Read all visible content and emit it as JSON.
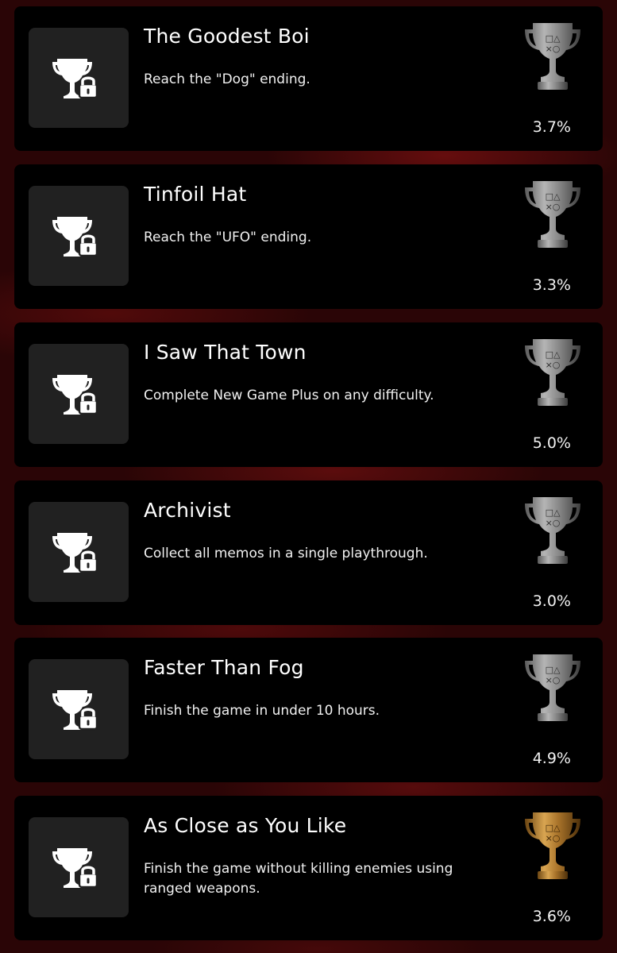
{
  "trophies": [
    {
      "title": "The Goodest Boi",
      "description": "Reach the \"Dog\" ending.",
      "rarity": "3.7%",
      "grade": "silver"
    },
    {
      "title": "Tinfoil Hat",
      "description": "Reach the \"UFO\" ending.",
      "rarity": "3.3%",
      "grade": "silver"
    },
    {
      "title": "I Saw That Town",
      "description": "Complete New Game Plus on any difficulty.",
      "rarity": "5.0%",
      "grade": "silver"
    },
    {
      "title": "Archivist",
      "description": "Collect all memos in a single playthrough.",
      "rarity": "3.0%",
      "grade": "silver"
    },
    {
      "title": "Faster Than Fog",
      "description": "Finish the game in under 10 hours.",
      "rarity": "4.9%",
      "grade": "silver"
    },
    {
      "title": "As Close as You Like",
      "description": "Finish the game without killing enemies using ranged weapons.",
      "rarity": "3.6%",
      "grade": "gold"
    }
  ],
  "icons": {
    "locked": "locked-trophy-icon",
    "grade": "playstation-trophy-cup-icon"
  },
  "colors": {
    "silver": "#8e8e8e",
    "gold": "#b07a2c",
    "card": "#000000",
    "icon_box": "#212121",
    "background": "#2a0506"
  }
}
